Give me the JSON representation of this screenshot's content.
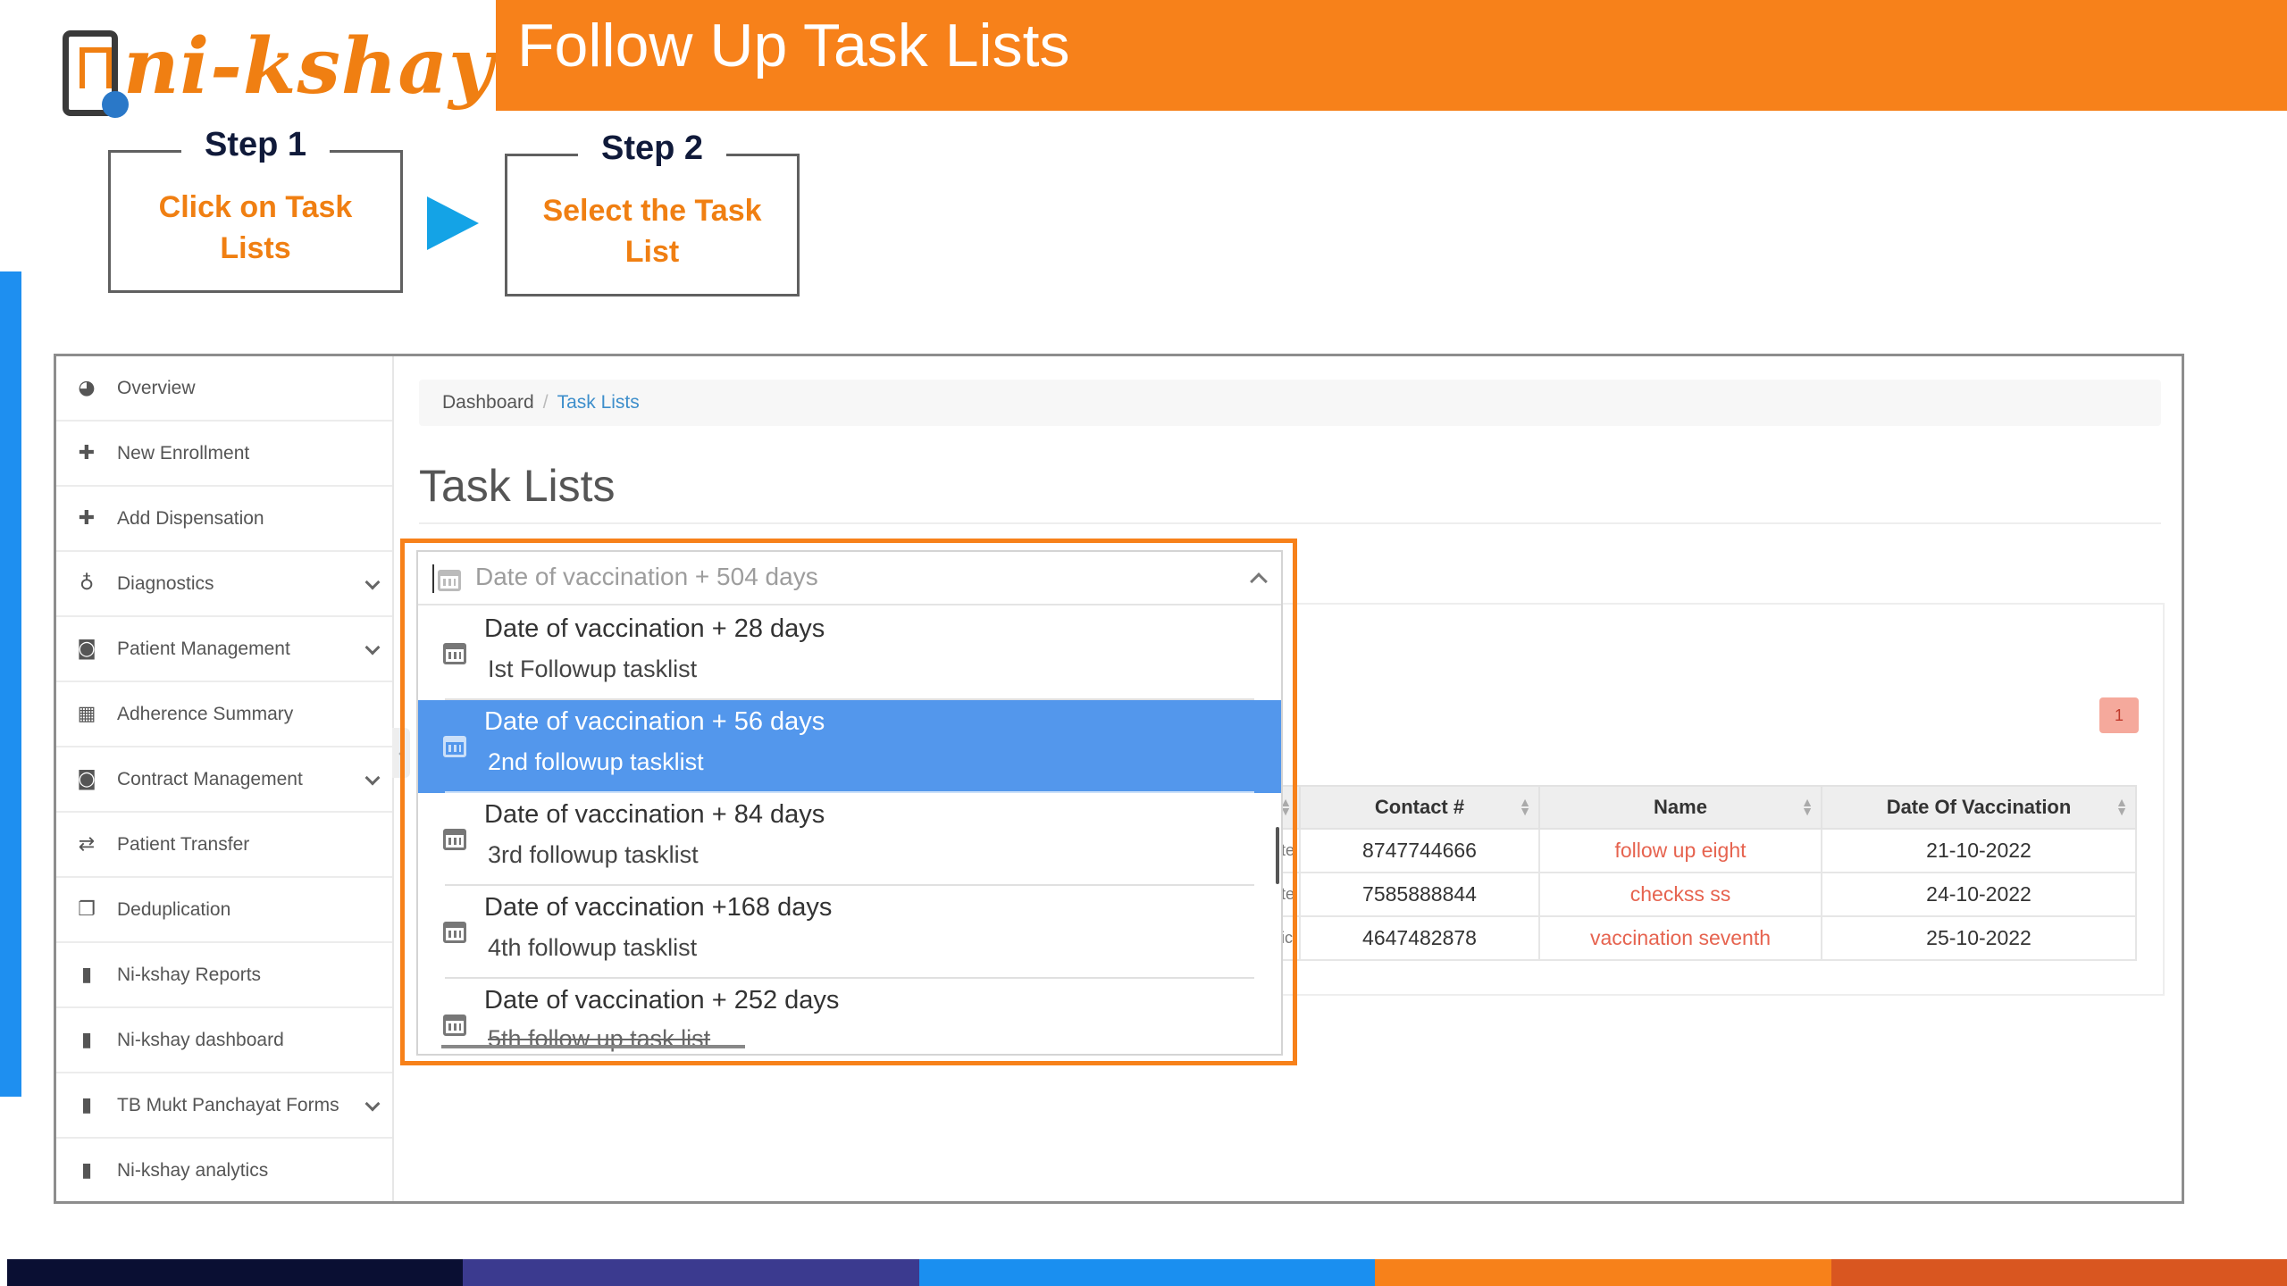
{
  "colors": {
    "accent_orange": "#f7811a",
    "accent_blue": "#1e8ff0",
    "selected_row": "#5397ec",
    "link_red": "#e6634f",
    "band": [
      "#0a0f33",
      "#3b3a8f",
      "#1a8ff0",
      "#f7811a",
      "#d95620"
    ]
  },
  "slide": {
    "logo_text": "ni-kshay",
    "title": "Follow Up Task Lists",
    "steps": [
      {
        "label": "Step 1",
        "desc_lines": [
          "Click on Task",
          "Lists"
        ]
      },
      {
        "label": "Step 2",
        "desc_lines": [
          "Select the Task",
          "List"
        ]
      }
    ]
  },
  "sidebar": {
    "items": [
      {
        "label": "Overview",
        "icon": "dashboard-icon",
        "glyph": "◕",
        "has_submenu": false
      },
      {
        "label": "New Enrollment",
        "icon": "plus-icon",
        "glyph": "✚",
        "has_submenu": false
      },
      {
        "label": "Add Dispensation",
        "icon": "plus-icon",
        "glyph": "✚",
        "has_submenu": false
      },
      {
        "label": "Diagnostics",
        "icon": "stethoscope-icon",
        "glyph": "♁",
        "has_submenu": true
      },
      {
        "label": "Patient Management",
        "icon": "camera-icon",
        "glyph": "◙",
        "has_submenu": true
      },
      {
        "label": "Adherence Summary",
        "icon": "calendar-icon",
        "glyph": "▦",
        "has_submenu": false
      },
      {
        "label": "Contract Management",
        "icon": "camera-icon",
        "glyph": "◙",
        "has_submenu": true
      },
      {
        "label": "Patient Transfer",
        "icon": "exchange-icon",
        "glyph": "⇄",
        "has_submenu": false
      },
      {
        "label": "Deduplication",
        "icon": "copy-icon",
        "glyph": "❐",
        "has_submenu": false
      },
      {
        "label": "Ni-kshay Reports",
        "icon": "file-icon",
        "glyph": "▮",
        "has_submenu": false
      },
      {
        "label": "Ni-kshay dashboard",
        "icon": "file-icon",
        "glyph": "▮",
        "has_submenu": false
      },
      {
        "label": "TB Mukt Panchayat Forms",
        "icon": "file-icon",
        "glyph": "▮",
        "has_submenu": true
      },
      {
        "label": "Ni-kshay analytics",
        "icon": "file-icon",
        "glyph": "▮",
        "has_submenu": false
      }
    ]
  },
  "breadcrumb": {
    "home": "Dashboard",
    "separator": "/",
    "current": "Task Lists"
  },
  "page_title": "Task Lists",
  "dropdown": {
    "selected_value": "Date of vaccination + 504 days",
    "options": [
      {
        "title": "Date of vaccination + 28 days",
        "subtitle": "Ist Followup tasklist",
        "selected": false
      },
      {
        "title": "Date of vaccination + 56 days",
        "subtitle": "2nd followup tasklist",
        "selected": true
      },
      {
        "title": "Date of vaccination + 84 days",
        "subtitle": "3rd followup tasklist",
        "selected": false
      },
      {
        "title": "Date of vaccination +168 days",
        "subtitle": "4th followup tasklist",
        "selected": false
      },
      {
        "title": "Date of vaccination + 252 days",
        "subtitle": "5th follow up task list",
        "selected": false
      }
    ]
  },
  "pagination": {
    "current_page": "1"
  },
  "table": {
    "columns": [
      "Contact #",
      "Name",
      "Date Of Vaccination"
    ],
    "rows": [
      {
        "clip": "te",
        "contact": "8747744666",
        "name": "follow up eight",
        "date": "21-10-2022"
      },
      {
        "clip": "te",
        "contact": "7585888844",
        "name": "checkss ss",
        "date": "24-10-2022"
      },
      {
        "clip": "ic",
        "contact": "4647482878",
        "name": "vaccination seventh",
        "date": "25-10-2022"
      }
    ]
  }
}
